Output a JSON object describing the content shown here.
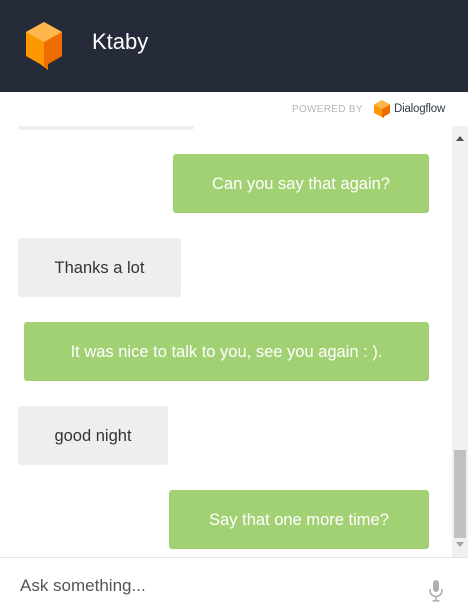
{
  "header": {
    "title": "Ktaby",
    "logo_icon": "dialogflow-agent-logo-icon",
    "logo_color": "#f98b1f"
  },
  "powered": {
    "label": "POWERED BY",
    "brand": "Dialogflow",
    "brand_icon": "dialogflow-logo-icon"
  },
  "messages": [
    {
      "from": "bot",
      "text": ""
    },
    {
      "from": "user",
      "text": "Can you say that again?"
    },
    {
      "from": "bot",
      "text": "Thanks a lot"
    },
    {
      "from": "user",
      "text": "It was nice to talk to you, see you again : )."
    },
    {
      "from": "bot",
      "text": "good night"
    },
    {
      "from": "user",
      "text": "Say that one more time?"
    }
  ],
  "input": {
    "placeholder": "Ask something...",
    "value": "",
    "mic_icon": "microphone-icon"
  },
  "colors": {
    "header_bg": "#252b38",
    "user_bubble": "#a2d173",
    "bot_bubble": "#eeeeee"
  }
}
